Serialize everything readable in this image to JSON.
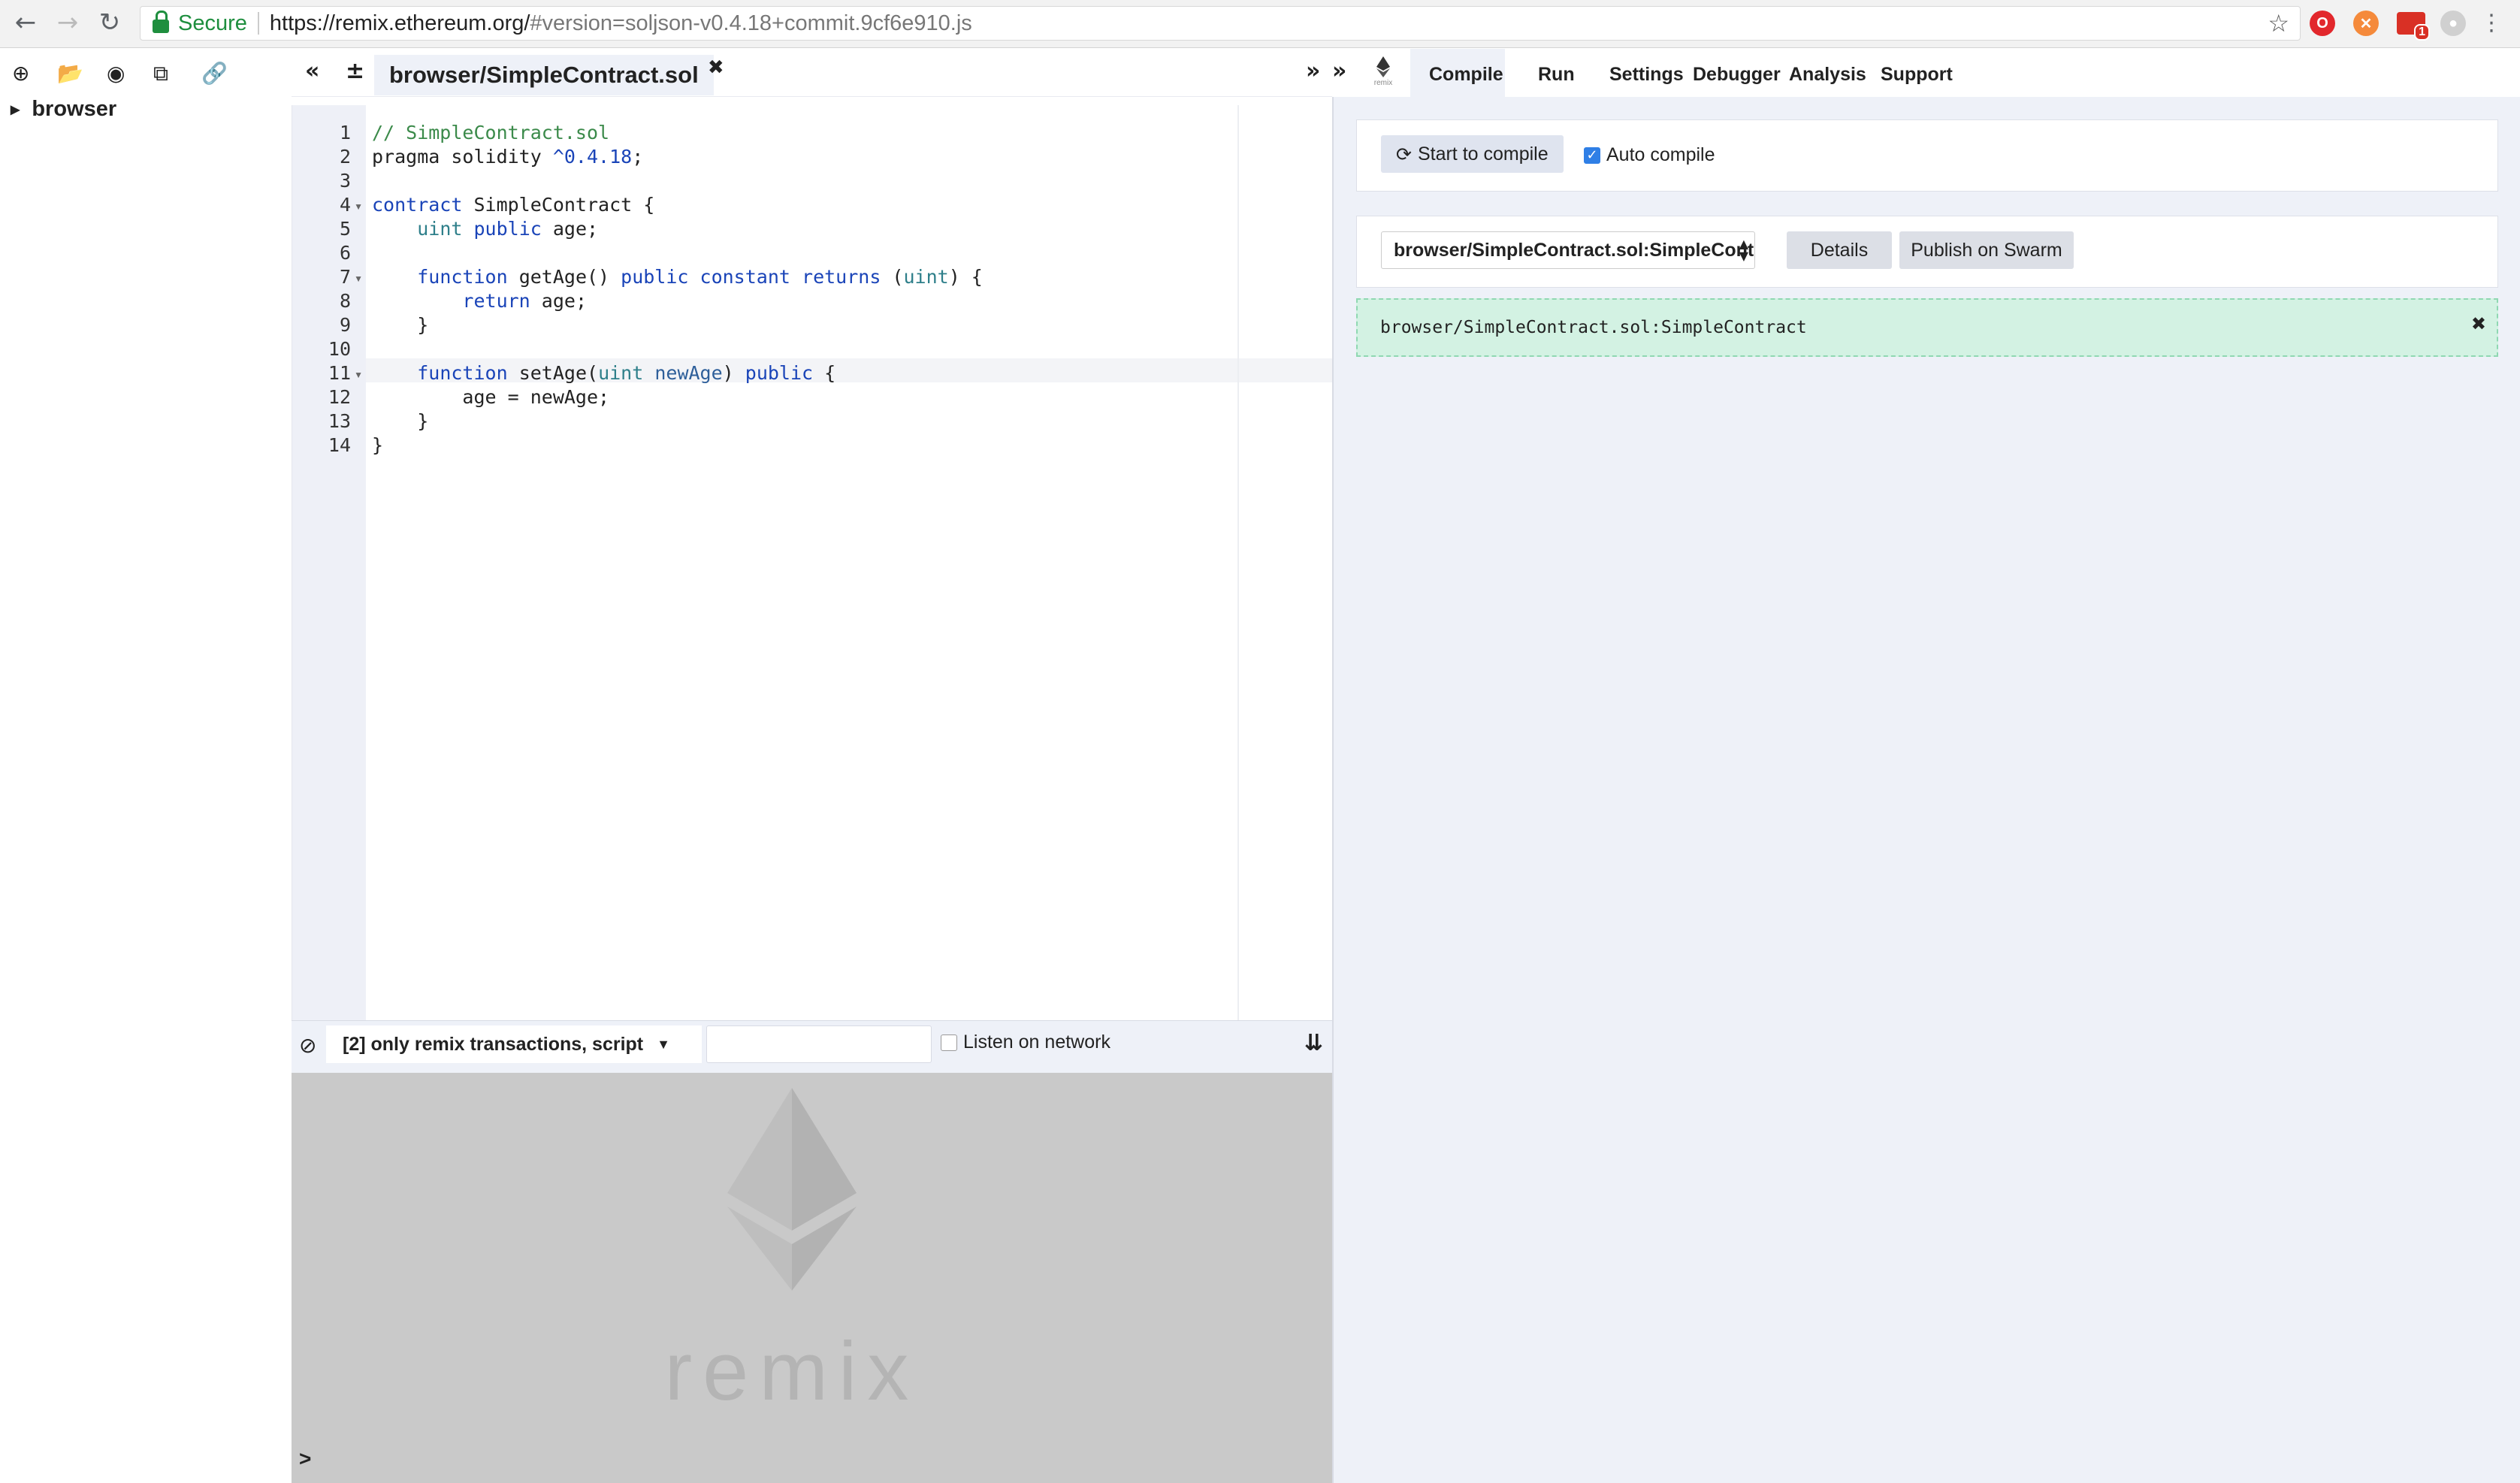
{
  "browser": {
    "secure_label": "Secure",
    "url_host": "https://remix.ethereum.org/",
    "url_path": "#version=soljson-v0.4.18+commit.9cf6e910.js",
    "extension_badge": "1"
  },
  "file_explorer": {
    "tree_root": "browser"
  },
  "editor": {
    "active_tab": "browser/SimpleContract.sol",
    "line_numbers": [
      "1",
      "2",
      "3",
      "4",
      "5",
      "6",
      "7",
      "8",
      "9",
      "10",
      "11",
      "12",
      "13",
      "14"
    ],
    "code": {
      "l1": "// SimpleContract.sol",
      "l2a": "pragma solidity ",
      "l2b": "^0.4.18",
      "l2c": ";",
      "l4a": "contract",
      "l4b": " SimpleContract {",
      "l5a": "    ",
      "l5b": "uint",
      "l5c": " ",
      "l5d": "public",
      "l5e": " age;",
      "l7a": "    ",
      "l7b": "function",
      "l7c": " getAge() ",
      "l7d": "public",
      "l7e": " ",
      "l7f": "constant",
      "l7g": " ",
      "l7h": "returns",
      "l7i": " (",
      "l7j": "uint",
      "l7k": ") {",
      "l8a": "        ",
      "l8b": "return",
      "l8c": " age;",
      "l9": "    }",
      "l11a": "    ",
      "l11b": "function",
      "l11c": " setAge(",
      "l11d": "uint",
      "l11e": " ",
      "l11f": "newAge",
      "l11g": ") ",
      "l11h": "public",
      "l11i": " {",
      "l12": "        age = newAge;",
      "l13": "    }",
      "l14": "}"
    }
  },
  "terminal": {
    "filter_label": "[2] only remix transactions, script",
    "listen_label": "Listen on network",
    "logo_text": "remix",
    "prompt": ">"
  },
  "right_panel": {
    "tabs": [
      "Compile",
      "Run",
      "Settings",
      "Debugger",
      "Analysis",
      "Support"
    ],
    "logo_caption": "remix",
    "compile_button": "Start to compile",
    "auto_compile_label": "Auto compile",
    "auto_compile_checked": true,
    "contract_selected": "browser/SimpleContract.sol:SimpleContract",
    "details_button": "Details",
    "publish_button": "Publish on Swarm",
    "success_message": "browser/SimpleContract.sol:SimpleContract"
  },
  "colors": {
    "accent_blue": "#2f7fe6",
    "success_bg": "#d3f2e3",
    "panel_bg": "#eef1f8",
    "keyword": "#1a44b8",
    "comment": "#3b8a4a"
  }
}
